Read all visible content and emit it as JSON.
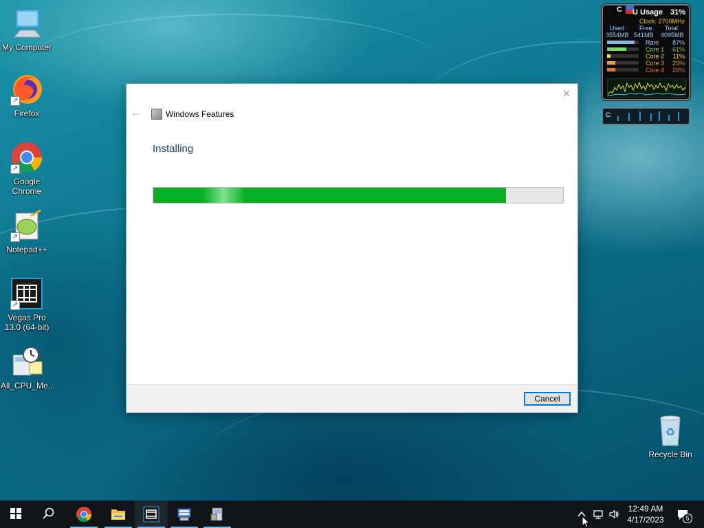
{
  "desktop": {
    "icons": [
      {
        "label": "My Computer"
      },
      {
        "label": "Firefox"
      },
      {
        "label": "Google Chrome"
      },
      {
        "label": "Notepad++"
      },
      {
        "label": "Vegas Pro 13.0 (64-bit)"
      },
      {
        "label": "All_CPU_Me..."
      },
      {
        "label": "Recycle Bin"
      }
    ]
  },
  "gadget": {
    "badge": "C",
    "title": "U Usage",
    "total_pct": "31%",
    "clock": "Clock: 2700MHz",
    "mem_headers": [
      "Used",
      "Free",
      "Total"
    ],
    "mem_values": [
      "3554MB",
      "541MB",
      "4095MB"
    ],
    "rows": [
      {
        "name": "Ram",
        "pct": "87%",
        "level": 0.87,
        "color": "#8fb8e0"
      },
      {
        "name": "Core 1",
        "pct": "61%",
        "level": 0.61,
        "color": "#7ed36a"
      },
      {
        "name": "Core 2",
        "pct": "11%",
        "level": 0.11,
        "color": "#f2e14a"
      },
      {
        "name": "Core 3",
        "pct": "25%",
        "level": 0.25,
        "color": "#f0a33a"
      },
      {
        "name": "Core 4",
        "pct": "26%",
        "level": 0.26,
        "color": "#e8782e"
      }
    ],
    "drive_label": "C:"
  },
  "dialog": {
    "app_title": "Windows Features",
    "heading": "Installing",
    "progress": 0.86,
    "cancel_label": "Cancel",
    "close_symbol": "×",
    "back_symbol": "←"
  },
  "taskbar": {
    "time": "12:49 AM",
    "date": "4/17/2023",
    "notification_count": "5"
  },
  "colors": {
    "accent": "#0078d7",
    "progress_green": "#06b025",
    "heading_blue": "#1e3f78"
  }
}
